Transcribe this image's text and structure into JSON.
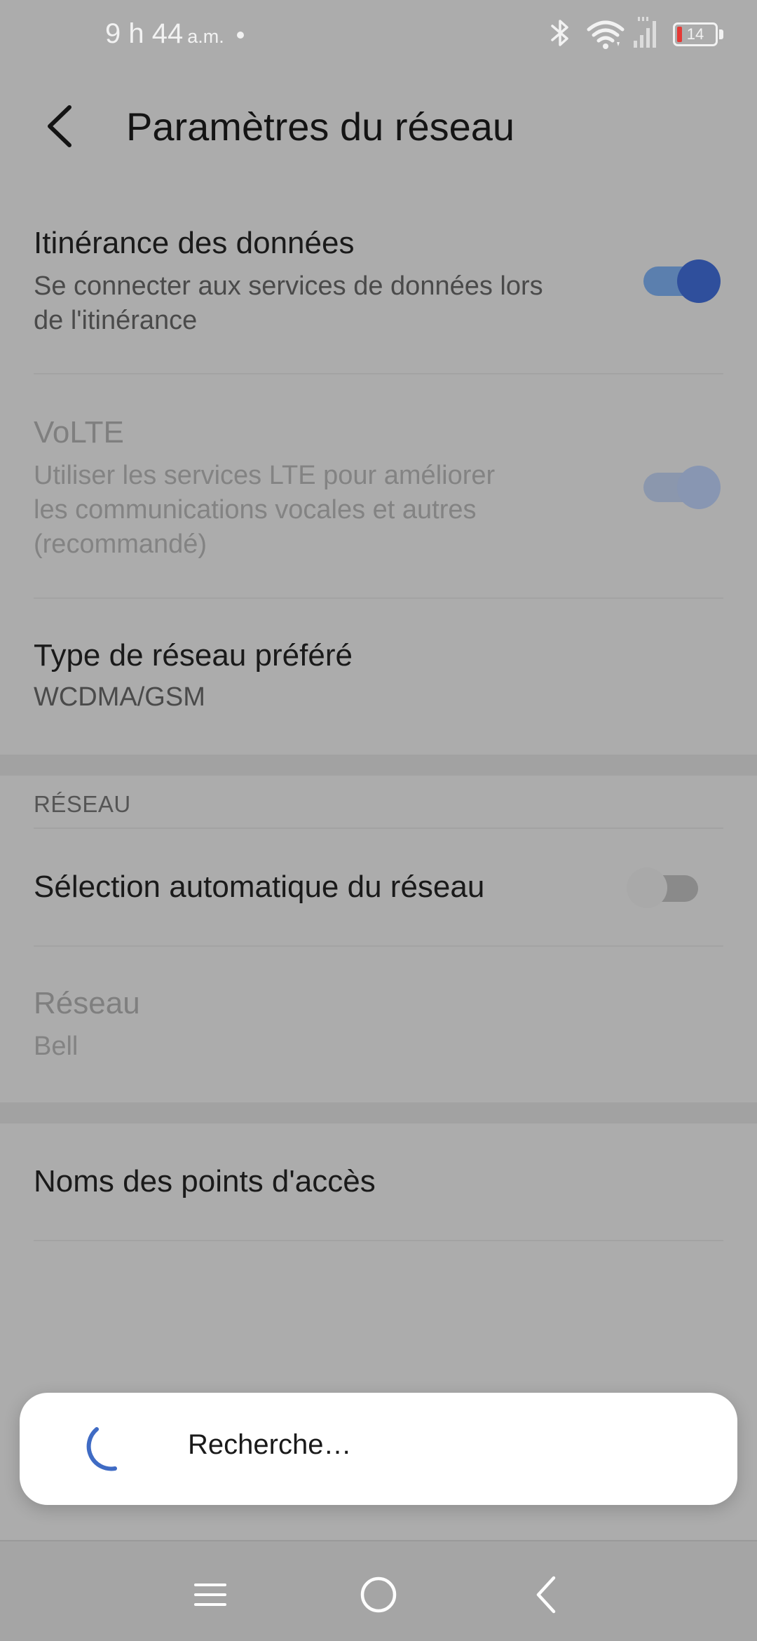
{
  "status_bar": {
    "time": "9 h 44",
    "ampm": "a.m.",
    "battery_level": "14",
    "battery_fraction": 0.14
  },
  "header": {
    "title": "Paramètres du réseau"
  },
  "settings": {
    "data_roaming": {
      "title": "Itinérance des données",
      "subtitle_line1": "Se connecter aux services de données lors",
      "subtitle_line2": "de l'itinérance",
      "enabled": true
    },
    "volte": {
      "title": "VoLTE",
      "subtitle_line1": "Utiliser les services LTE pour améliorer",
      "subtitle_line2": "les communications vocales et autres",
      "subtitle_line3": "(recommandé)",
      "enabled": true,
      "disabled_row": true
    },
    "preferred_network": {
      "title": "Type de réseau préféré",
      "value": "WCDMA/GSM"
    }
  },
  "network_section": {
    "header": "RÉSEAU",
    "auto_select": {
      "title": "Sélection automatique du réseau",
      "enabled": false
    },
    "network": {
      "title": "Réseau",
      "value": "Bell"
    }
  },
  "apn": {
    "title": "Noms des points d'accès"
  },
  "dialog": {
    "text": "Recherche…"
  },
  "icons": {
    "back": "back-arrow-icon",
    "bluetooth": "bluetooth-icon",
    "wifi": "wifi-icon",
    "signal": "signal-icon",
    "battery": "battery-icon",
    "spinner": "loading-spinner-icon",
    "nav_menu": "menu-icon",
    "nav_home": "home-icon",
    "nav_back": "back-icon"
  },
  "colors": {
    "accent": "#2f4f9c",
    "toggle_track_on": "#5b7fae",
    "toggle_off_track": "#8a8a8a",
    "spinner": "#3f6bc4"
  }
}
